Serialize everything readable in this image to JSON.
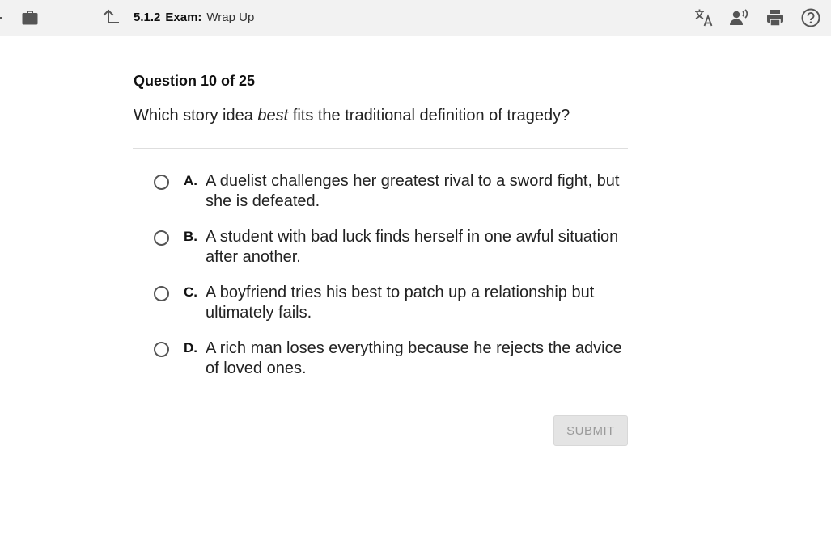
{
  "header": {
    "code": "5.1.2",
    "type": "Exam:",
    "name": "Wrap Up",
    "icons": [
      "briefcase-icon",
      "up-arrow-icon",
      "translate-icon",
      "read-aloud-icon",
      "print-icon",
      "help-icon"
    ]
  },
  "question": {
    "number_label": "Question 10 of 25",
    "prompt_before": "Which story idea ",
    "prompt_emphasis": "best",
    "prompt_after": " fits the traditional definition of tragedy?"
  },
  "choices": [
    {
      "letter": "A.",
      "text": "A duelist challenges her greatest rival to a sword fight, but she is defeated."
    },
    {
      "letter": "B.",
      "text": "A student with bad luck finds herself in one awful situation after another."
    },
    {
      "letter": "C.",
      "text": "A boyfriend tries his best to patch up a relationship but ultimately fails."
    },
    {
      "letter": "D.",
      "text": "A rich man loses everything because he rejects the advice of loved ones."
    }
  ],
  "submit_label": "SUBMIT",
  "colors": {
    "topbar_bg": "#f2f2f2",
    "icon": "#555555",
    "submit_bg": "#e4e4e4",
    "submit_text": "#9a9a9a"
  }
}
